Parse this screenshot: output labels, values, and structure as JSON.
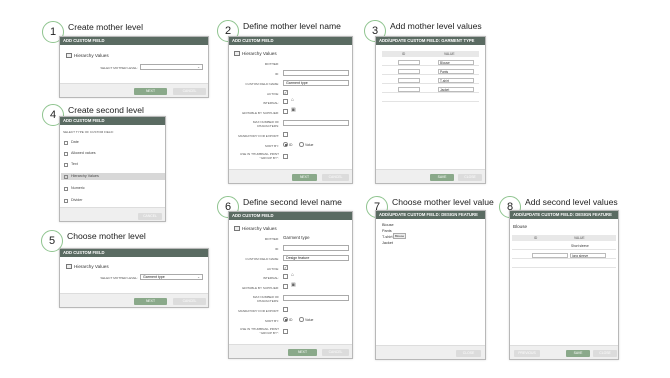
{
  "steps": [
    {
      "num": "1",
      "title": "Create mother level"
    },
    {
      "num": "2",
      "title": "Define mother level name"
    },
    {
      "num": "3",
      "title": "Add mother level values"
    },
    {
      "num": "4",
      "title": "Create second level"
    },
    {
      "num": "5",
      "title": "Choose mother level"
    },
    {
      "num": "6",
      "title": "Define second level name"
    },
    {
      "num": "7",
      "title": "Choose mother level value"
    },
    {
      "num": "8",
      "title": "Add second level values"
    }
  ],
  "panel1": {
    "header": "ADD CUSTOM FIELD",
    "field_type": "Hierarchy Values",
    "select_label": "SELECT MOTHER LEVEL:",
    "select_value": "",
    "next": "NEXT",
    "cancel": "CANCEL"
  },
  "panel2": {
    "header": "ADD CUSTOM FIELD",
    "field_type": "Hierarchy Values",
    "labels": {
      "mother": "MOTHER:",
      "id": "ID:",
      "name": "CUSTOM FIELD NAME:",
      "active": "ACTIVE:",
      "internal": "INTERNAL:",
      "editable": "EDITABLE BY SUPPLIER:",
      "max": "MAX NUMBER OF CHARACTERS:",
      "mandatory": "MANDATORY FOR EXPORT:",
      "sort": "SORT BY:",
      "thumbnail": "USE IN THUMBNAIL PRINT \"GROUP BY\":"
    },
    "mother_value": "",
    "name_value": "Garment type",
    "sort_id": "ID",
    "sort_value": "Value",
    "next": "NEXT",
    "cancel": "CANCEL"
  },
  "panel3": {
    "header": "ADD/UPDATE CUSTOM FIELD: GARMENT TYPE",
    "col_id": "ID",
    "col_value": "VALUE",
    "values": [
      "Blouse",
      "Pants",
      "T-shirt",
      "Jacket"
    ],
    "save": "SAVE",
    "close": "CLOSE"
  },
  "panel4": {
    "header": "ADD CUSTOM FIELD",
    "subtitle": "SELECT TYPE OF CUSTOM FIELD:",
    "types": [
      "Date",
      "Allowed values",
      "Text",
      "Hierarchy Values",
      "Numeric",
      "Divider"
    ],
    "selected_index": 3,
    "cancel": "CANCEL"
  },
  "panel5": {
    "header": "ADD CUSTOM FIELD",
    "field_type": "Hierarchy Values",
    "select_label": "SELECT MOTHER LEVEL:",
    "select_value": "Garment type",
    "next": "NEXT",
    "cancel": "CANCEL"
  },
  "panel6": {
    "header": "ADD CUSTOM FIELD",
    "field_type": "Hierarchy Values",
    "labels": {
      "mother": "MOTHER:",
      "id": "ID:",
      "name": "CUSTOM FIELD NAME:",
      "active": "ACTIVE:",
      "internal": "INTERNAL:",
      "editable": "EDITABLE BY SUPPLIER:",
      "max": "MAX NUMBER OF CHARACTERS:",
      "mandatory": "MANDATORY FOR EXPORT:",
      "sort": "SORT BY:",
      "thumbnail": "USE IN THUMBNAIL PRINT \"GROUP BY\":"
    },
    "mother_value": "Garment type",
    "name_value": "Design feature",
    "sort_id": "ID",
    "sort_value": "Value",
    "next": "NEXT",
    "cancel": "CANCEL"
  },
  "panel7": {
    "header": "ADD/UPDATE CUSTOM FIELD: DESIGN FEATURE",
    "items": [
      "Blouse",
      "Pants",
      "T-shirt",
      "Jacket"
    ],
    "tooltip": "Blouse",
    "close": "CLOSE"
  },
  "panel8": {
    "header": "ADD/UPDATE CUSTOM FIELD: DESIGN FEATURE",
    "parent": "Blouse",
    "col_id": "ID",
    "col_value": "VALUE",
    "values": [
      "Short sleeve",
      "long sleeve"
    ],
    "previous": "PREVIOUS",
    "save": "SAVE",
    "close": "CLOSE"
  }
}
